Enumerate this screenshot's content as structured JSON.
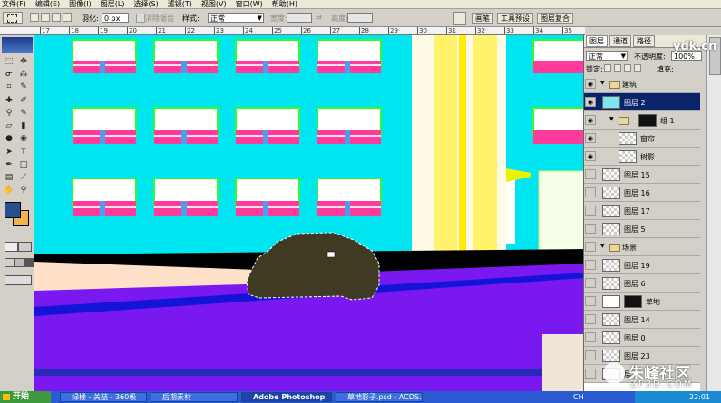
{
  "menu": [
    "文件(F)",
    "编辑(E)",
    "图像(I)",
    "图层(L)",
    "选择(S)",
    "滤镜(T)",
    "视图(V)",
    "窗口(W)",
    "帮助(H)"
  ],
  "options": {
    "feather_label": "羽化:",
    "feather_value": "0 px",
    "antialias_label": "消除锯齿",
    "style_label": "样式:",
    "style_value": "正常",
    "width_label": "宽度:",
    "height_label": "高度:"
  },
  "palette_tabs": [
    "画笔",
    "工具预设",
    "图层复合"
  ],
  "ruler_ticks": [
    "17",
    "18",
    "19",
    "20",
    "21",
    "22",
    "23",
    "24",
    "25",
    "26",
    "27",
    "28",
    "29",
    "30",
    "31",
    "32",
    "33",
    "34",
    "35"
  ],
  "layers_panel": {
    "tabs": [
      "图层",
      "通道",
      "路径"
    ],
    "blend_mode": "正常",
    "opacity_label": "不透明度:",
    "opacity_value": "100%",
    "lock_label": "锁定:",
    "fill_label": "填充:",
    "rows": [
      {
        "name": "建筑",
        "kind": "group"
      },
      {
        "name": "图层 2",
        "kind": "layer",
        "selected": true
      },
      {
        "name": "组 1",
        "kind": "group"
      },
      {
        "name": "窗帘",
        "kind": "layer"
      },
      {
        "name": "树影",
        "kind": "layer"
      },
      {
        "name": "图层 15",
        "kind": "layer"
      },
      {
        "name": "图层 16",
        "kind": "layer"
      },
      {
        "name": "图层 17",
        "kind": "layer"
      },
      {
        "name": "图层 5",
        "kind": "layer"
      },
      {
        "name": "场景",
        "kind": "group"
      },
      {
        "name": "图层 19",
        "kind": "layer"
      },
      {
        "name": "图层 6",
        "kind": "layer"
      },
      {
        "name": "草地",
        "kind": "layer"
      },
      {
        "name": "图层 14",
        "kind": "layer"
      },
      {
        "name": "图层 0",
        "kind": "layer"
      },
      {
        "name": "图层 23",
        "kind": "layer"
      },
      {
        "name": "层",
        "kind": "layer"
      }
    ]
  },
  "watermark": {
    "text": "朱峰社区",
    "url": "ZF3D.COM",
    "top": "ydk.cn"
  },
  "taskbar": {
    "start": "开始",
    "tasks": [
      "绿楼 - 关喆 - 360极",
      "后期素材",
      "Adobe Photoshop",
      "草地影子.psd - ACDS..."
    ],
    "lang": "CH",
    "time": "22:01"
  },
  "colors": {
    "sky": "#00e6f0",
    "ground": "#7a18f0",
    "car": "#403a22",
    "building": "#ffffff",
    "stripe": "#ff3b9c",
    "window_frame": "#2aff2a"
  }
}
